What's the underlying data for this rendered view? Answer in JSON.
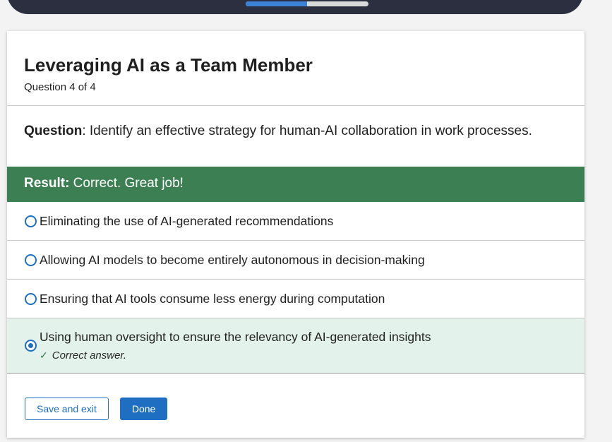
{
  "progress": {
    "fraction": 0.5
  },
  "quiz": {
    "title": "Leveraging AI as a Team Member",
    "progress_label": "Question 4 of 4",
    "question_prefix": "Question",
    "question_text": ": Identify an effective strategy for human-AI collaboration in work processes.",
    "result_prefix": "Result:",
    "result_text": " Correct. Great job!",
    "result_color": "#3c7f53",
    "options": [
      {
        "label": "Eliminating the use of AI-generated recommendations",
        "selected": false
      },
      {
        "label": "Allowing AI models to become entirely autonomous in decision-making",
        "selected": false
      },
      {
        "label": "Ensuring that AI tools consume less energy during computation",
        "selected": false
      },
      {
        "label": "Using human oversight to ensure the relevancy of AI-generated insights",
        "selected": true,
        "feedback": "Correct answer."
      }
    ]
  },
  "footer": {
    "save_label": "Save and exit",
    "done_label": "Done",
    "accent_color": "#1e6fc2"
  }
}
